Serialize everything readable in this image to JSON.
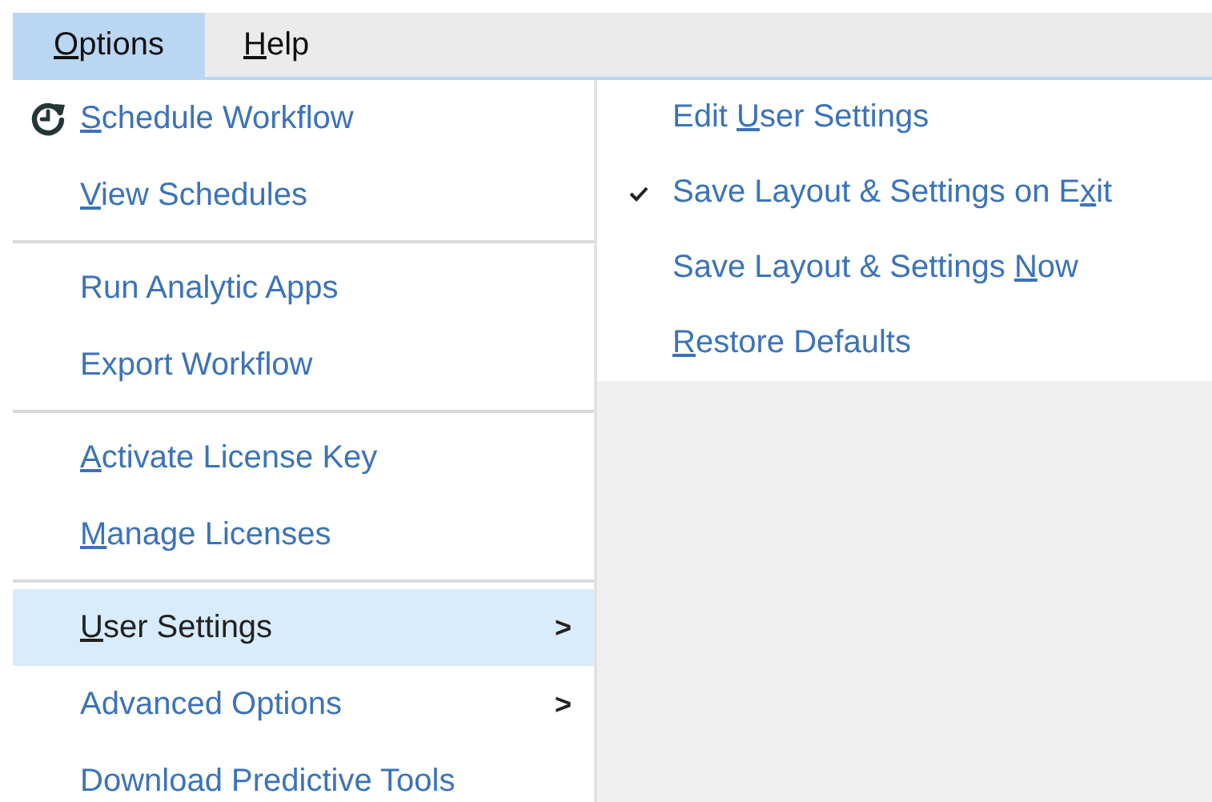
{
  "menubar": [
    {
      "access_key": "O",
      "label_end": "ptions",
      "selected": true
    },
    {
      "access_key": "H",
      "label_end": "elp",
      "selected": false
    }
  ],
  "menu": {
    "items": [
      {
        "kind": "icon_item",
        "access_key": "S",
        "label_end": "chedule Workflow",
        "selected": false
      },
      {
        "kind": "item",
        "access_key": "V",
        "label_end": "iew Schedules",
        "selected": false
      },
      {
        "kind": "separator"
      },
      {
        "kind": "item",
        "label": "Run Analytic Apps",
        "selected": false
      },
      {
        "kind": "item",
        "label": "Export Workflow",
        "selected": false
      },
      {
        "kind": "separator"
      },
      {
        "kind": "item",
        "access_key": "A",
        "label_end": "ctivate License Key",
        "selected": false
      },
      {
        "kind": "item",
        "access_key": "M",
        "label_end": "anage Licenses",
        "selected": false
      },
      {
        "kind": "separator"
      },
      {
        "kind": "item",
        "access_key": "U",
        "label_end": "ser Settings",
        "selected": true,
        "arrow": ">"
      },
      {
        "kind": "item",
        "label": "Advanced Options",
        "selected": false,
        "arrow": ">"
      },
      {
        "kind": "item",
        "label": "Download Predictive Tools",
        "selected": false
      }
    ]
  },
  "submenu": {
    "items": [
      {
        "label_start": "Edit ",
        "access_key": "U",
        "label_end": "ser Settings",
        "checked": false
      },
      {
        "label_start": "Save Layout & Settings on E",
        "access_key": "x",
        "label_end": "it",
        "checked": true
      },
      {
        "label_start": "Save Layout & Settings ",
        "access_key": "N",
        "label_end": "ow",
        "checked": false
      },
      {
        "access_key": "R",
        "label_end": "estore Defaults",
        "checked": false
      }
    ]
  }
}
